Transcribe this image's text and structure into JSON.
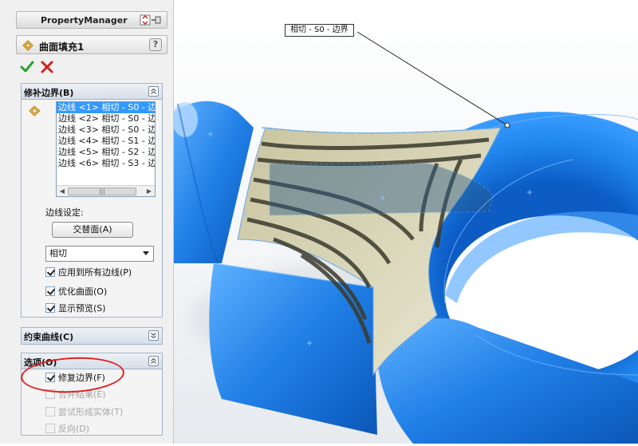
{
  "property_manager": {
    "title": "PropertyManager",
    "feature_name": "曲面填充1",
    "help_label": "?",
    "groups": {
      "patch_boundary": {
        "title": "修补边界(B)",
        "edges": [
          "边线 <1> 相切 - S0 - 边",
          "边线 <2> 相切 - S0 - 边",
          "边线 <3> 相切 - S0 - 边",
          "边线 <4> 相切 - S1 - 边",
          "边线 <5> 相切 - S2 - 边",
          "边线 <6> 相切 - S3 - 边"
        ],
        "edge_settings_label": "边线设定:",
        "alternate_face_button": "交替面(A)",
        "condition_value": "相切",
        "apply_all_edges": {
          "label": "应用到所有边线(P)",
          "checked": true
        },
        "optimize_surface": {
          "label": "优化曲面(O)",
          "checked": true
        },
        "show_preview": {
          "label": "显示预览(S)",
          "checked": true
        }
      },
      "constraint_curves": {
        "title": "约束曲线(C)"
      },
      "options": {
        "title": "选项(O)",
        "fix_boundary": {
          "label": "修复边界(F)",
          "checked": true
        },
        "merge_result": {
          "label": "合并结果(E)",
          "checked": false
        },
        "try_form_solid": {
          "label": "尝试形成实体(T)",
          "checked": false
        },
        "reverse": {
          "label": "反向(D)",
          "checked": false
        }
      }
    }
  },
  "viewport": {
    "callout_label": "相切 - S0 - 边界"
  },
  "colors": {
    "surface_blue": "#1f7fe6",
    "fill_patch": "#d9d6b8",
    "highlight": "#3399ff",
    "annotation_red": "#e02020"
  }
}
